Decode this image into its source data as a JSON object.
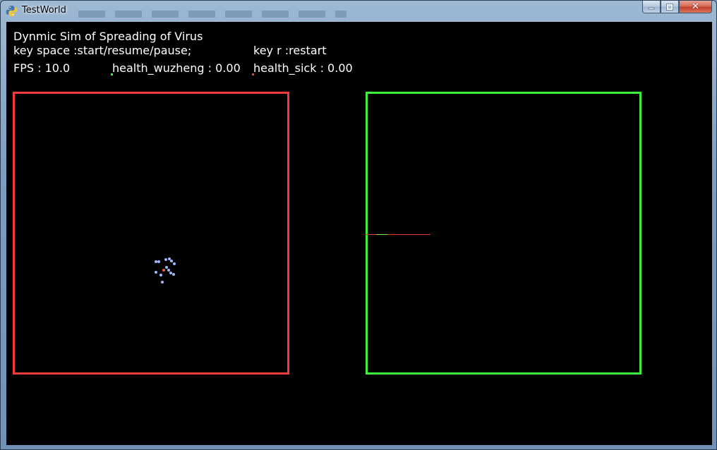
{
  "window": {
    "title": "TestWorld",
    "close_glyph": "✕",
    "minimize_glyph": "▁",
    "maximize_glyph": "□",
    "app_icon": "python-snake-icon"
  },
  "hud": {
    "title": "Dynmic Sim of Spreading of Virus",
    "key_space": "key space :start/resume/pause;",
    "key_r": "key r :restart",
    "fps": "FPS : 10.0",
    "health_wuzheng": "health_wuzheng : 0.00",
    "health_sick": "health_sick : 0.00"
  },
  "colors": {
    "background": "#000000",
    "text": "#ffffff",
    "sim_box_border": "#f03c3c",
    "chart_box_border": "#3ef03e",
    "healthy_particle": "#9fb8ff",
    "sick_particle": "#e85a48",
    "wuzheng_marker": "#3ef03e",
    "sick_marker": "#f03c3c"
  }
}
